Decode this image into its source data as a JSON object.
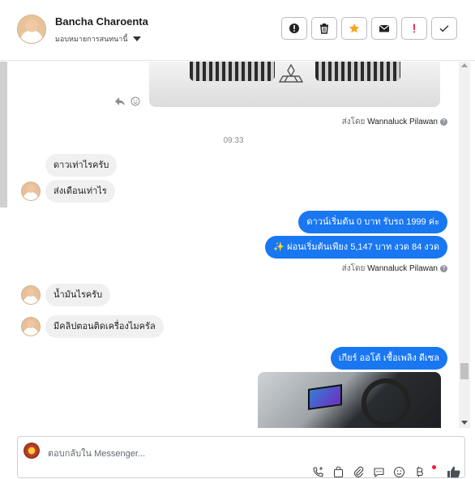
{
  "header": {
    "name": "Bancha Charoenta",
    "assign_label": "มอบหมายการสนทนานี้",
    "actions": [
      "spam-icon",
      "trash-icon",
      "star-icon",
      "envelope-icon",
      "important-icon",
      "check-icon"
    ],
    "star_color": "#f5a623",
    "important_color": "#e41e3f"
  },
  "thread": {
    "sent_by_1": "ส่งโดย",
    "sent_by_1_name": "Wannaluck Pilawan",
    "timestamp": "09:33",
    "msg_in_1": "ดาวเท่าไรครับ",
    "msg_in_2": "ส่งเดือนเท่าไร",
    "msg_out_1": "ดาวน์เริ่มต้น 0 บาท รับรถ 1999 ค่ะ",
    "msg_out_2": "✨ ผ่อนเริ่มต้นเพียง 5,147 บาท งวด 84 งวด",
    "sent_by_2": "ส่งโดย",
    "sent_by_2_name": "Wannaluck Pilawan",
    "msg_in_3": "น้ำมันไรครับ",
    "msg_in_4": "มีคลิปตอนติดเครื่องไมครัล",
    "msg_out_3": "เกียร์ ออโต้  เชื้อเพลิง ดีเซล",
    "accent_color": "#1977f2"
  },
  "composer": {
    "placeholder": "ตอบกลับใน Messenger...",
    "tools": [
      "call-add-icon",
      "bag-icon",
      "attach-icon",
      "chat-icon",
      "emoji-icon",
      "bitcoin-icon",
      "like-icon"
    ]
  }
}
